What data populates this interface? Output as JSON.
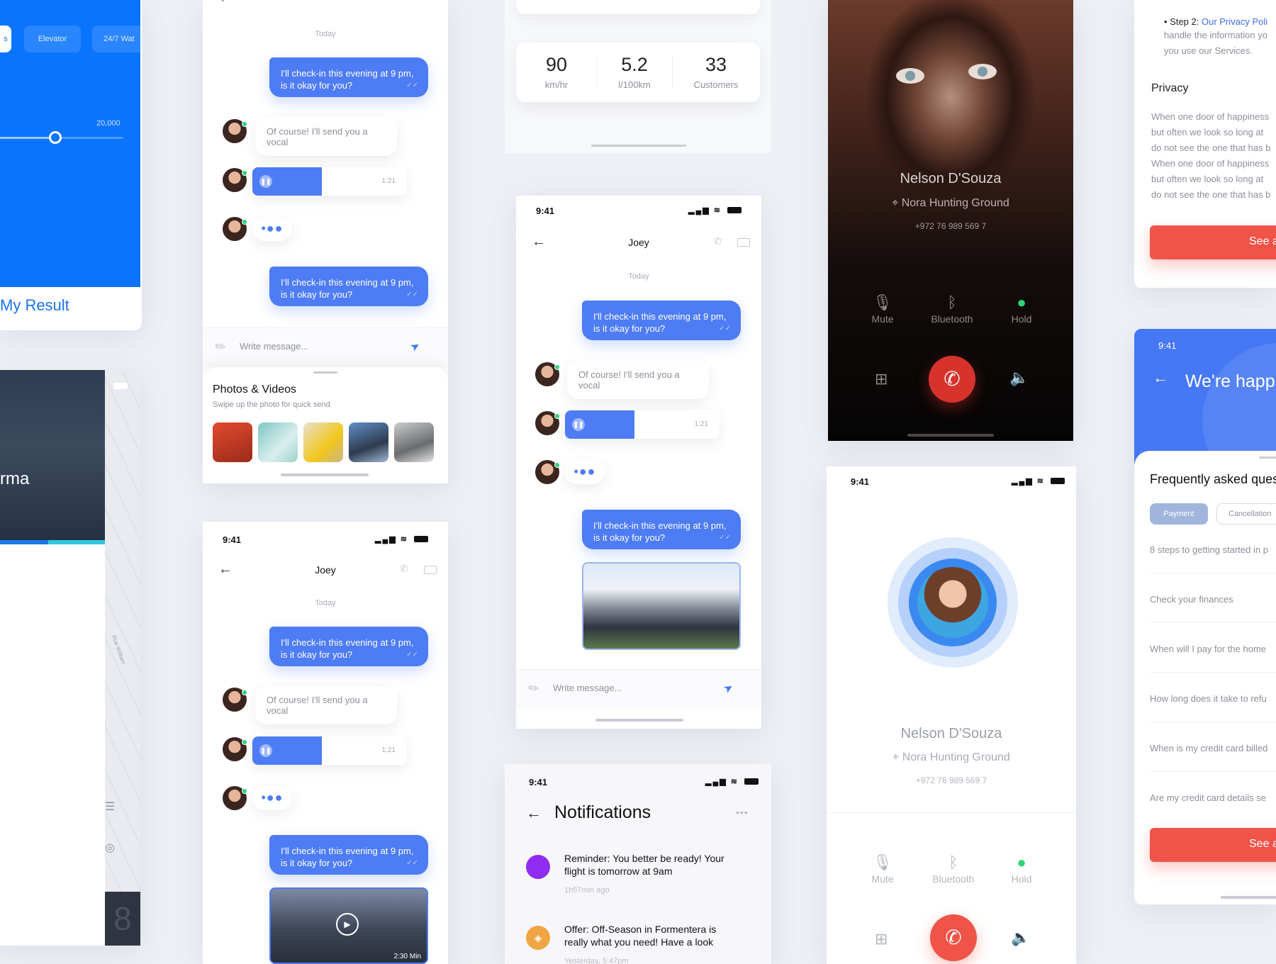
{
  "filter_card": {
    "chip_first": "s",
    "chip_elevator": "Elevator",
    "chip_water": "24/7 Wat",
    "slider_max": "20,000",
    "slider_value_pct": 0.45,
    "result_link": "My Result"
  },
  "map_card": {
    "title_fragment": "rma",
    "street": "Rue William",
    "tab_fragment": "8"
  },
  "chat_top": {
    "day": "Today",
    "out_msg": "I'll check-in this evening at 9 pm, is it okay for you?",
    "in_msg": "Of course! I'll send you a vocal",
    "voice_duration": "1:21",
    "typing": "•●●",
    "ticks": "✓✓",
    "composer_placeholder": "Write message...",
    "photos_title": "Photos & Videos",
    "photos_subtitle": "Swipe up the photo for quick send"
  },
  "chat_bottom": {
    "time": "9:41",
    "title": "Joey",
    "day": "Today",
    "out_msg": "I'll check-in this evening at 9 pm, is it okay for you?",
    "in_msg": "Of course! I'll send you a vocal",
    "voice_duration": "1:21",
    "typing": "•●●",
    "video_duration": "2:30 Min"
  },
  "stats_card": {
    "items": [
      {
        "value": "90",
        "unit": "km/hr"
      },
      {
        "value": "5.2",
        "unit": "l/100km"
      },
      {
        "value": "33",
        "unit": "Customers"
      }
    ]
  },
  "chat_center": {
    "time": "9:41",
    "title": "Joey",
    "day": "Today",
    "out_msg": "I'll check-in this evening at 9 pm, is it okay for you?",
    "in_msg": "Of course! I'll send you a vocal",
    "voice_duration": "1:21",
    "typing": "•●●",
    "composer_placeholder": "Write message..."
  },
  "notifications": {
    "time": "9:41",
    "title": "Notifications",
    "more": "•••",
    "items": [
      {
        "text": "Reminder: You better be ready! Your flight is tomorrow at 9am",
        "time": "1h57min ago",
        "color": "#8f2cf0"
      },
      {
        "text": "Offer: Off-Season in Formentera is really what you need! Have a look",
        "time": "Yesterday, 5:47pm",
        "color": "#f0a544"
      }
    ]
  },
  "call_dark": {
    "name": "Nelson D'Souza",
    "location": "Nora Hunting Ground",
    "phone": "+972 76 989 569 7",
    "actions": [
      "Mute",
      "Bluetooth",
      "Hold"
    ]
  },
  "call_light": {
    "time": "9:41",
    "name": "Nelson D'Souza",
    "location": "Nora Hunting Ground",
    "phone": "+972 76 989 569 7",
    "actions": [
      "Mute",
      "Bluetooth",
      "Hold"
    ]
  },
  "privacy_card": {
    "step_label": "• Step 2:",
    "step_text": "Our Privacy Poli",
    "step_line2": "handle the information yo",
    "step_line3": "you use our Services.",
    "heading": "Privacy",
    "paragraph": [
      "When one door of happiness",
      "but often we look so long at",
      "do not see the one that has b",
      "When one door of happiness",
      "but often we look so long at",
      "do not see the one that has b"
    ],
    "button": "See a"
  },
  "faq_card": {
    "time": "9:41",
    "header": "We're happ",
    "title": "Frequently asked ques",
    "tab_active": "Payment",
    "tab_other": "Cancellation",
    "questions": [
      "8 steps to getting started in p",
      "Check your finances",
      "When will I pay for the home",
      "How long does it take to refu",
      "When is my credit card billed",
      "Are my credit card details se"
    ],
    "button": "See a"
  },
  "colors": {
    "accent": "#4d7cf5",
    "blue_panel": "#0b74ff",
    "danger": "#f05449",
    "online": "#2ed47a"
  }
}
